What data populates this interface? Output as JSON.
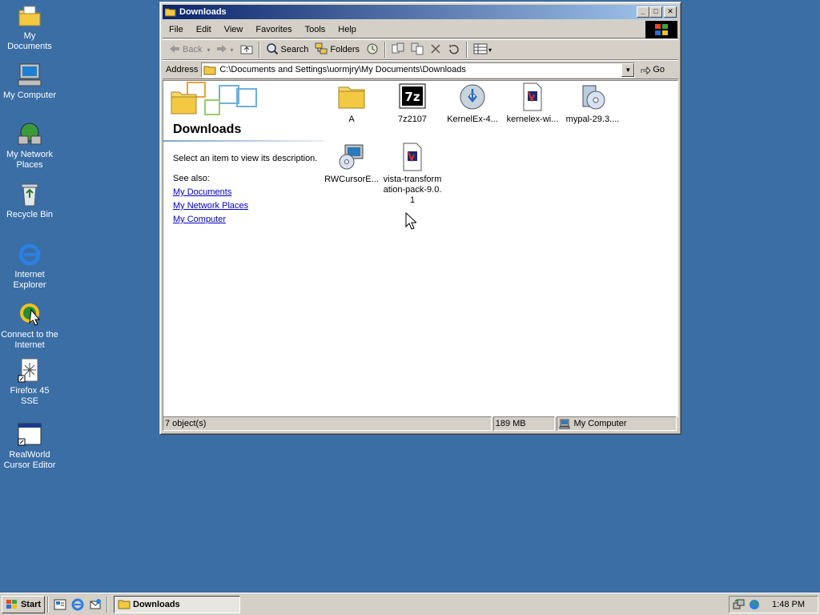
{
  "desktop": {
    "icons": [
      {
        "label": "My Documents",
        "icon": "my-documents-icon"
      },
      {
        "label": "My Computer",
        "icon": "my-computer-icon"
      },
      {
        "label": "My Network Places",
        "icon": "network-places-icon"
      },
      {
        "label": "Recycle Bin",
        "icon": "recycle-bin-icon"
      },
      {
        "label": "Internet Explorer",
        "icon": "internet-explorer-icon"
      },
      {
        "label": "Connect to the Internet",
        "icon": "connect-internet-icon"
      },
      {
        "label": "Firefox 45 SSE",
        "icon": "firefox-shortcut-icon"
      },
      {
        "label": "RealWorld Cursor Editor",
        "icon": "cursor-editor-icon"
      }
    ]
  },
  "window": {
    "title": "Downloads",
    "menu": [
      "File",
      "Edit",
      "View",
      "Favorites",
      "Tools",
      "Help"
    ],
    "toolbar": {
      "back": "Back",
      "search": "Search",
      "folders": "Folders"
    },
    "address": {
      "label": "Address",
      "value": "C:\\Documents and Settings\\uormjry\\My Documents\\Downloads",
      "go": "Go"
    },
    "sidebar": {
      "title": "Downloads",
      "description": "Select an item to view its description.",
      "see_also": "See also:",
      "links": [
        "My Documents",
        "My Network Places",
        "My Computer"
      ]
    },
    "files": [
      {
        "name": "A",
        "icon": "folder-icon"
      },
      {
        "name": "7z2107",
        "icon": "7zip-installer-icon"
      },
      {
        "name": "KernelEx-4...",
        "icon": "installer-disc-icon"
      },
      {
        "name": "kernelex-wi...",
        "icon": "setup-file-icon"
      },
      {
        "name": "mypal-29.3....",
        "icon": "setup-disc-icon"
      },
      {
        "name": "RWCursorE...",
        "icon": "setup-computer-icon"
      },
      {
        "name": "vista-transformation-pack-9.0.1",
        "icon": "setup-file-icon"
      }
    ],
    "status": {
      "objects": "7 object(s)",
      "size": "189 MB",
      "zone": "My Computer"
    }
  },
  "taskbar": {
    "start": "Start",
    "task": "Downloads",
    "clock": "1:48 PM"
  },
  "colors": {
    "desktop": "#3a6ea5",
    "title_active": "#0a246a",
    "chrome": "#d4d0c8",
    "link": "#0000cc"
  }
}
